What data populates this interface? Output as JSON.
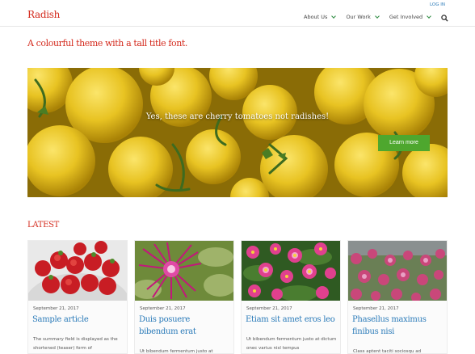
{
  "header": {
    "logo": "Radish",
    "login": "LOG IN",
    "nav": [
      {
        "label": "About Us"
      },
      {
        "label": "Our Work"
      },
      {
        "label": "Get Involved"
      }
    ]
  },
  "tagline": "A colourful theme with a tall title font.",
  "hero": {
    "text": "Yes, these are cherry tomatoes not radishes!",
    "button": "Learn more"
  },
  "latest": {
    "title": "LATEST",
    "cards": [
      {
        "date": "September 21, 2017",
        "title": "Sample article",
        "excerpt": "The summary field is displayed as the shortened (teaser) form of"
      },
      {
        "date": "September 21, 2017",
        "title": "Duis posuere bibendum erat",
        "excerpt": "Ut bibendum fermentum justo at"
      },
      {
        "date": "September 21, 2017",
        "title": "Etiam sit amet eros leo",
        "excerpt": "Ut bibendum fermentum justo at dictum onec varius nisl tempus"
      },
      {
        "date": "September 21, 2017",
        "title": "Phasellus maximus finibus nisi",
        "excerpt": "Class aptent taciti sociosqu ad"
      }
    ]
  },
  "colors": {
    "brand": "#d42b1e",
    "link": "#2b7bb9",
    "button": "#4ea72e"
  }
}
